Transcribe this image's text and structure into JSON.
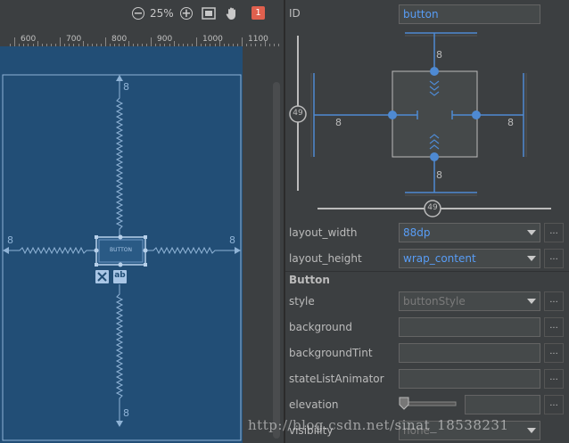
{
  "toolbar": {
    "zoom": "25%",
    "issue_count": "1"
  },
  "ruler": {
    "labels": [
      "600",
      "700",
      "800",
      "900",
      "1000",
      "1100"
    ]
  },
  "canvas": {
    "margin_top": "8",
    "margin_bottom": "8",
    "margin_left": "8",
    "margin_right": "8",
    "button_label": "BUTTON",
    "baseline_badge": "ab"
  },
  "inspector": {
    "id_label": "ID",
    "id_value": "button",
    "margin_top": "8",
    "margin_bottom": "8",
    "margin_left": "8",
    "margin_right": "8",
    "vertical_bias": "49",
    "horizontal_bias": "49",
    "layout_width_label": "layout_width",
    "layout_width_value": "88dp",
    "layout_height_label": "layout_height",
    "layout_height_value": "wrap_content",
    "section_title": "Button",
    "style_label": "style",
    "style_value": "buttonStyle",
    "background_label": "background",
    "background_tint_label": "backgroundTint",
    "state_list_animator_label": "stateListAnimator",
    "elevation_label": "elevation",
    "visibility_label": "visibility",
    "visibility_value": "none",
    "dots": "..."
  },
  "watermark": "http://blog.csdn.net/sinat_18538231",
  "colors": {
    "blueprint": "#224e76",
    "accent": "#4e8ad3",
    "line": "#7fa8d0"
  }
}
